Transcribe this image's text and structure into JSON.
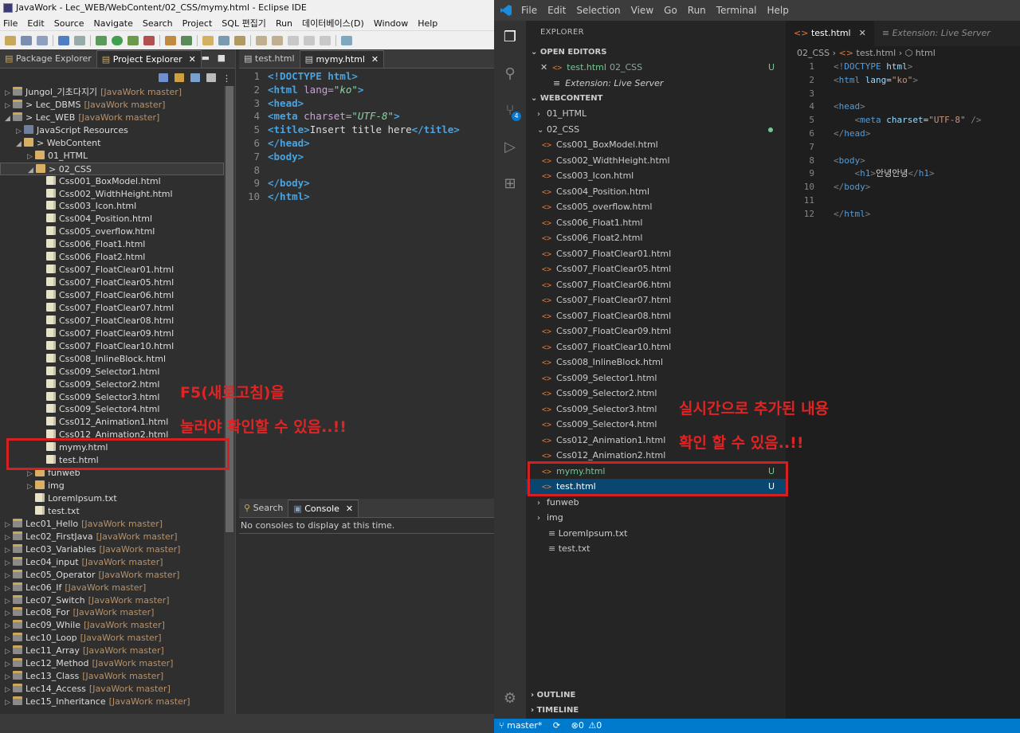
{
  "eclipse": {
    "title": "JavaWork - Lec_WEB/WebContent/02_CSS/mymy.html - Eclipse IDE",
    "menu": [
      "File",
      "Edit",
      "Source",
      "Navigate",
      "Search",
      "Project",
      "SQL 편집기",
      "Run",
      "데이터베이스(D)",
      "Window",
      "Help"
    ],
    "left_tabs": {
      "package_explorer": "Package Explorer",
      "project_explorer": "Project Explorer"
    },
    "tree": [
      {
        "label": "Jungol_기초다지기",
        "branch": "[JavaWork master]",
        "level": 0,
        "kind": "proj",
        "tw": "▷"
      },
      {
        "label": "> Lec_DBMS",
        "branch": "[JavaWork master]",
        "level": 0,
        "kind": "proj",
        "tw": "▷"
      },
      {
        "label": "> Lec_WEB",
        "branch": "[JavaWork master]",
        "level": 0,
        "kind": "proj",
        "tw": "◢"
      },
      {
        "label": "JavaScript Resources",
        "branch": "",
        "level": 1,
        "kind": "js",
        "tw": "▷"
      },
      {
        "label": "> WebContent",
        "branch": "",
        "level": 1,
        "kind": "fold",
        "tw": "◢"
      },
      {
        "label": "01_HTML",
        "branch": "",
        "level": 2,
        "kind": "fold",
        "tw": "▷"
      },
      {
        "label": "> 02_CSS",
        "branch": "",
        "level": 2,
        "kind": "fold",
        "tw": "◢",
        "sel": true
      },
      {
        "label": "Css001_BoxModel.html",
        "branch": "",
        "level": 3,
        "kind": "file"
      },
      {
        "label": "Css002_WidthHeight.html",
        "branch": "",
        "level": 3,
        "kind": "file"
      },
      {
        "label": "Css003_Icon.html",
        "branch": "",
        "level": 3,
        "kind": "file"
      },
      {
        "label": "Css004_Position.html",
        "branch": "",
        "level": 3,
        "kind": "file"
      },
      {
        "label": "Css005_overflow.html",
        "branch": "",
        "level": 3,
        "kind": "file"
      },
      {
        "label": "Css006_Float1.html",
        "branch": "",
        "level": 3,
        "kind": "file"
      },
      {
        "label": "Css006_Float2.html",
        "branch": "",
        "level": 3,
        "kind": "file"
      },
      {
        "label": "Css007_FloatClear01.html",
        "branch": "",
        "level": 3,
        "kind": "file"
      },
      {
        "label": "Css007_FloatClear05.html",
        "branch": "",
        "level": 3,
        "kind": "file"
      },
      {
        "label": "Css007_FloatClear06.html",
        "branch": "",
        "level": 3,
        "kind": "file"
      },
      {
        "label": "Css007_FloatClear07.html",
        "branch": "",
        "level": 3,
        "kind": "file"
      },
      {
        "label": "Css007_FloatClear08.html",
        "branch": "",
        "level": 3,
        "kind": "file"
      },
      {
        "label": "Css007_FloatClear09.html",
        "branch": "",
        "level": 3,
        "kind": "file"
      },
      {
        "label": "Css007_FloatClear10.html",
        "branch": "",
        "level": 3,
        "kind": "file"
      },
      {
        "label": "Css008_InlineBlock.html",
        "branch": "",
        "level": 3,
        "kind": "file"
      },
      {
        "label": "Css009_Selector1.html",
        "branch": "",
        "level": 3,
        "kind": "file"
      },
      {
        "label": "Css009_Selector2.html",
        "branch": "",
        "level": 3,
        "kind": "file"
      },
      {
        "label": "Css009_Selector3.html",
        "branch": "",
        "level": 3,
        "kind": "file"
      },
      {
        "label": "Css009_Selector4.html",
        "branch": "",
        "level": 3,
        "kind": "file"
      },
      {
        "label": "Css012_Animation1.html",
        "branch": "",
        "level": 3,
        "kind": "file"
      },
      {
        "label": "Css012_Animation2.html",
        "branch": "",
        "level": 3,
        "kind": "file"
      },
      {
        "label": "mymy.html",
        "branch": "",
        "level": 3,
        "kind": "file"
      },
      {
        "label": "test.html",
        "branch": "",
        "level": 3,
        "kind": "file"
      },
      {
        "label": "funweb",
        "branch": "",
        "level": 2,
        "kind": "fold",
        "tw": "▷"
      },
      {
        "label": "img",
        "branch": "",
        "level": 2,
        "kind": "fold",
        "tw": "▷"
      },
      {
        "label": "LoremIpsum.txt",
        "branch": "",
        "level": 2,
        "kind": "file"
      },
      {
        "label": "test.txt",
        "branch": "",
        "level": 2,
        "kind": "file"
      },
      {
        "label": "Lec01_Hello",
        "branch": "[JavaWork master]",
        "level": 0,
        "kind": "proj",
        "tw": "▷"
      },
      {
        "label": "Lec02_FirstJava",
        "branch": "[JavaWork master]",
        "level": 0,
        "kind": "proj",
        "tw": "▷"
      },
      {
        "label": "Lec03_Variables",
        "branch": "[JavaWork master]",
        "level": 0,
        "kind": "proj",
        "tw": "▷"
      },
      {
        "label": "Lec04_input",
        "branch": "[JavaWork master]",
        "level": 0,
        "kind": "proj",
        "tw": "▷"
      },
      {
        "label": "Lec05_Operator",
        "branch": "[JavaWork master]",
        "level": 0,
        "kind": "proj",
        "tw": "▷"
      },
      {
        "label": "Lec06_If",
        "branch": "[JavaWork master]",
        "level": 0,
        "kind": "proj",
        "tw": "▷"
      },
      {
        "label": "Lec07_Switch",
        "branch": "[JavaWork master]",
        "level": 0,
        "kind": "proj",
        "tw": "▷"
      },
      {
        "label": "Lec08_For",
        "branch": "[JavaWork master]",
        "level": 0,
        "kind": "proj",
        "tw": "▷"
      },
      {
        "label": "Lec09_While",
        "branch": "[JavaWork master]",
        "level": 0,
        "kind": "proj",
        "tw": "▷"
      },
      {
        "label": "Lec10_Loop",
        "branch": "[JavaWork master]",
        "level": 0,
        "kind": "proj",
        "tw": "▷"
      },
      {
        "label": "Lec11_Array",
        "branch": "[JavaWork master]",
        "level": 0,
        "kind": "proj",
        "tw": "▷"
      },
      {
        "label": "Lec12_Method",
        "branch": "[JavaWork master]",
        "level": 0,
        "kind": "proj",
        "tw": "▷"
      },
      {
        "label": "Lec13_Class",
        "branch": "[JavaWork master]",
        "level": 0,
        "kind": "proj",
        "tw": "▷"
      },
      {
        "label": "Lec14_Access",
        "branch": "[JavaWork master]",
        "level": 0,
        "kind": "proj",
        "tw": "▷"
      },
      {
        "label": "Lec15_Inheritance",
        "branch": "[JavaWork master]",
        "level": 0,
        "kind": "proj",
        "tw": "▷"
      }
    ],
    "editor_tabs": {
      "test": "test.html",
      "mymy": "mymy.html"
    },
    "code_lines": [
      [
        [
          "kw",
          "<!DOCTYPE html>"
        ]
      ],
      [
        [
          "kw",
          "<html "
        ],
        [
          "at",
          "lang="
        ],
        [
          "st",
          "\"ko\""
        ],
        [
          "kw",
          ">"
        ]
      ],
      [
        [
          "kw",
          "<head>"
        ]
      ],
      [
        [
          "kw",
          "<meta "
        ],
        [
          "at",
          "charset="
        ],
        [
          "st",
          "\"UTF-8\""
        ],
        [
          "kw",
          ">"
        ]
      ],
      [
        [
          "kw",
          "<title>"
        ],
        [
          "tx",
          "Insert title here"
        ],
        [
          "kw",
          "</title>"
        ]
      ],
      [
        [
          "kw",
          "</head>"
        ]
      ],
      [
        [
          "kw",
          "<body>"
        ]
      ],
      [],
      [
        [
          "kw",
          "</body>"
        ]
      ],
      [
        [
          "kw",
          "</html>"
        ]
      ]
    ],
    "console_tabs": {
      "search": "Search",
      "console": "Console"
    },
    "console_message": "No consoles to display at this time.",
    "annotation_line1": "F5(새로고침)을",
    "annotation_line2": "눌러야 확인할 수 있음..!!"
  },
  "vscode": {
    "menu": [
      "File",
      "Edit",
      "Selection",
      "View",
      "Go",
      "Run",
      "Terminal",
      "Help"
    ],
    "explorer_label": "EXPLORER",
    "open_editors_label": "OPEN EDITORS",
    "open_editors": [
      {
        "name": "test.html",
        "path": "02_CSS",
        "status": "U"
      },
      {
        "name": "Extension: Live Server",
        "path": "",
        "status": ""
      }
    ],
    "workspace_label": "WEBCONTENT",
    "files": [
      {
        "name": "01_HTML",
        "type": "folder-closed"
      },
      {
        "name": "02_CSS",
        "type": "folder-open",
        "dot": true
      },
      {
        "name": "Css001_BoxModel.html",
        "type": "html"
      },
      {
        "name": "Css002_WidthHeight.html",
        "type": "html"
      },
      {
        "name": "Css003_Icon.html",
        "type": "html"
      },
      {
        "name": "Css004_Position.html",
        "type": "html"
      },
      {
        "name": "Css005_overflow.html",
        "type": "html"
      },
      {
        "name": "Css006_Float1.html",
        "type": "html"
      },
      {
        "name": "Css006_Float2.html",
        "type": "html"
      },
      {
        "name": "Css007_FloatClear01.html",
        "type": "html"
      },
      {
        "name": "Css007_FloatClear05.html",
        "type": "html"
      },
      {
        "name": "Css007_FloatClear06.html",
        "type": "html"
      },
      {
        "name": "Css007_FloatClear07.html",
        "type": "html"
      },
      {
        "name": "Css007_FloatClear08.html",
        "type": "html"
      },
      {
        "name": "Css007_FloatClear09.html",
        "type": "html"
      },
      {
        "name": "Css007_FloatClear10.html",
        "type": "html"
      },
      {
        "name": "Css008_InlineBlock.html",
        "type": "html"
      },
      {
        "name": "Css009_Selector1.html",
        "type": "html"
      },
      {
        "name": "Css009_Selector2.html",
        "type": "html"
      },
      {
        "name": "Css009_Selector3.html",
        "type": "html"
      },
      {
        "name": "Css009_Selector4.html",
        "type": "html"
      },
      {
        "name": "Css012_Animation1.html",
        "type": "html"
      },
      {
        "name": "Css012_Animation2.html",
        "type": "html"
      },
      {
        "name": "mymy.html",
        "type": "html",
        "status": "U",
        "git": true
      },
      {
        "name": "test.html",
        "type": "html",
        "status": "U",
        "sel": true
      },
      {
        "name": "funweb",
        "type": "folder-closed-top"
      },
      {
        "name": "img",
        "type": "folder-closed-top"
      },
      {
        "name": "LoremIpsum.txt",
        "type": "txt"
      },
      {
        "name": "test.txt",
        "type": "txt"
      }
    ],
    "outline_label": "OUTLINE",
    "timeline_label": "TIMELINE",
    "tabs": {
      "active": "test.html",
      "other": "Extension: Live Server"
    },
    "breadcrumb": {
      "folder": "02_CSS",
      "file": "test.html",
      "symbol": "html"
    },
    "code_lines": [
      [
        [
          "p",
          "<!"
        ],
        [
          "k",
          "DOCTYPE "
        ],
        [
          "a",
          "html"
        ],
        [
          "p",
          ">"
        ]
      ],
      [
        [
          "p",
          "<"
        ],
        [
          "k",
          "html "
        ],
        [
          "a",
          "lang"
        ],
        [
          "t",
          "="
        ],
        [
          "s",
          "\"ko\""
        ],
        [
          "p",
          ">"
        ]
      ],
      [],
      [
        [
          "p",
          "<"
        ],
        [
          "k",
          "head"
        ],
        [
          "p",
          ">"
        ]
      ],
      [
        [
          "t",
          "    "
        ],
        [
          "p",
          "<"
        ],
        [
          "k",
          "meta "
        ],
        [
          "a",
          "charset"
        ],
        [
          "t",
          "="
        ],
        [
          "s",
          "\"UTF-8\""
        ],
        [
          "t",
          " "
        ],
        [
          "p",
          "/>"
        ]
      ],
      [
        [
          "p",
          "</"
        ],
        [
          "k",
          "head"
        ],
        [
          "p",
          ">"
        ]
      ],
      [],
      [
        [
          "p",
          "<"
        ],
        [
          "k",
          "body"
        ],
        [
          "p",
          ">"
        ]
      ],
      [
        [
          "t",
          "    "
        ],
        [
          "p",
          "<"
        ],
        [
          "k",
          "h1"
        ],
        [
          "p",
          ">"
        ],
        [
          "t",
          "안녕안녕"
        ],
        [
          "p",
          "</"
        ],
        [
          "k",
          "h1"
        ],
        [
          "p",
          ">"
        ]
      ],
      [
        [
          "p",
          "</"
        ],
        [
          "k",
          "body"
        ],
        [
          "p",
          ">"
        ]
      ],
      [],
      [
        [
          "p",
          "</"
        ],
        [
          "k",
          "html"
        ],
        [
          "p",
          ">"
        ]
      ]
    ],
    "status": {
      "branch": "master*",
      "errors": "0",
      "warnings": "0"
    },
    "annotation_line1": "실시간으로 추가된 내용",
    "annotation_line2": "확인 할 수 있음..!!"
  },
  "colors": {
    "annotation": "#e02424",
    "vscode_status": "#007acc",
    "git_untracked": "#73c991"
  }
}
